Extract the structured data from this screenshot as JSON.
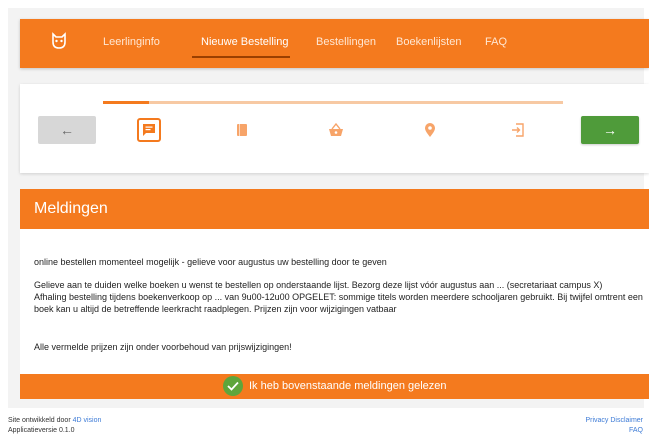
{
  "navbar": {
    "logo_icon": "owl-logo-icon",
    "items": [
      {
        "label": "Leerlinginfo",
        "active": false
      },
      {
        "label": "Nieuwe Bestelling",
        "active": true
      },
      {
        "label": "Bestellingen",
        "active": false
      },
      {
        "label": "Boekenlijsten",
        "active": false
      },
      {
        "label": "FAQ",
        "active": false
      }
    ],
    "color": "#f47a1e"
  },
  "stepper": {
    "progress_fraction": 0.1,
    "back_icon": "arrow-left-icon",
    "next_icon": "arrow-right-icon",
    "back_symbol": "←",
    "next_symbol": "→",
    "steps": [
      {
        "icon": "message-icon",
        "current": true
      },
      {
        "icon": "book-icon",
        "current": false
      },
      {
        "icon": "basket-icon",
        "current": false
      },
      {
        "icon": "location-pin-icon",
        "current": false
      },
      {
        "icon": "login-icon",
        "current": false
      }
    ],
    "next_color": "#4f9b3a"
  },
  "meldingen": {
    "title": "Meldingen",
    "messages": [
      "online bestellen momenteel mogelijk - gelieve voor augustus uw bestelling door te geven",
      "Gelieve aan te duiden welke boeken u wenst te bestellen op onderstaande lijst. Bezorg deze lijst vóór augustus aan ... (secretariaat campus X)",
      "Afhaling bestelling tijdens boekenverkoop op ... van 9u00-12u00 OPGELET: sommige titels worden meerdere schooljaren gebruikt. Bij twijfel omtrent een boek kan u altijd de betreffende leerkracht raadplegen. Prijzen zijn voor wijzigingen vatbaar",
      "Alle vermelde prijzen zijn onder voorbehoud van prijswijzigingen!"
    ],
    "confirm_label": "Ik heb bovenstaande meldingen gelezen",
    "confirm_icon": "check-icon"
  },
  "footer": {
    "developed_by": "Site ontwikkeld door",
    "developer_link": "4D vision",
    "version": "Applicatieversie 0.1.0",
    "privacy": "Privacy Disclaimer",
    "faq": "FAQ"
  }
}
